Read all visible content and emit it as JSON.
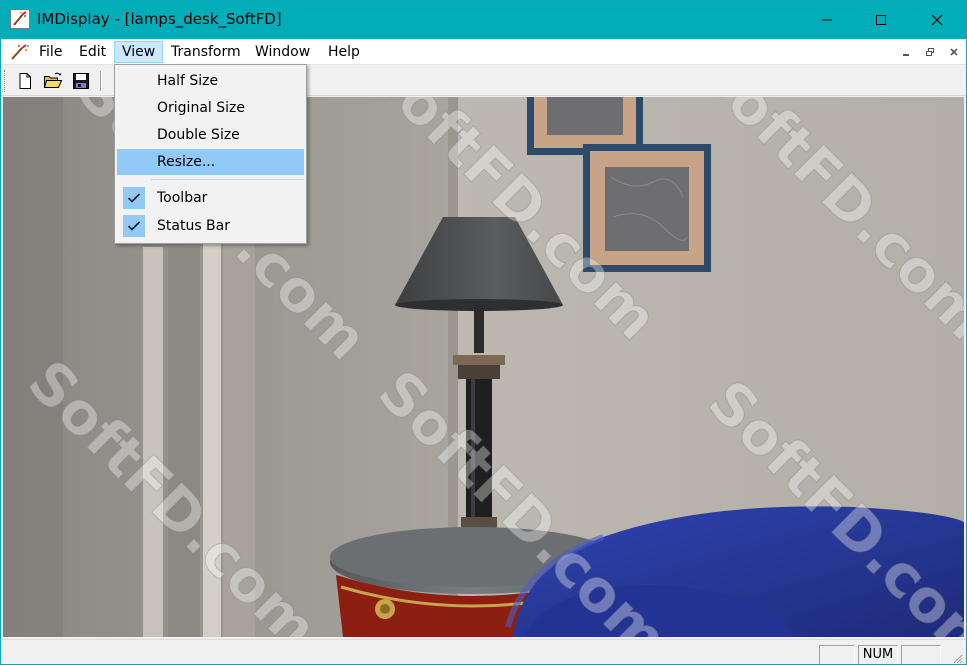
{
  "window": {
    "title": "IMDisplay - [lamps_desk_SoftFD]"
  },
  "menubar": {
    "items": [
      "File",
      "Edit",
      "View",
      "Transform",
      "Window",
      "Help"
    ]
  },
  "view_menu": {
    "items": [
      {
        "label": "Half Size",
        "checked": false
      },
      {
        "label": "Original Size",
        "checked": false
      },
      {
        "label": "Double Size",
        "checked": false
      },
      {
        "label": "Resize...",
        "checked": false,
        "highlighted": true
      },
      {
        "label": "Toolbar",
        "checked": true
      },
      {
        "label": "Status Bar",
        "checked": true
      }
    ]
  },
  "toolbar": {
    "buttons": [
      "new-icon",
      "open-icon",
      "save-icon"
    ]
  },
  "statusbar": {
    "num_indicator": "NUM"
  },
  "watermark": {
    "text": "SoftFD.com"
  },
  "colors": {
    "titlebar": "#00adb8",
    "menu_highlight": "#91c9f7",
    "chair_blue": "#2c3d9e"
  }
}
